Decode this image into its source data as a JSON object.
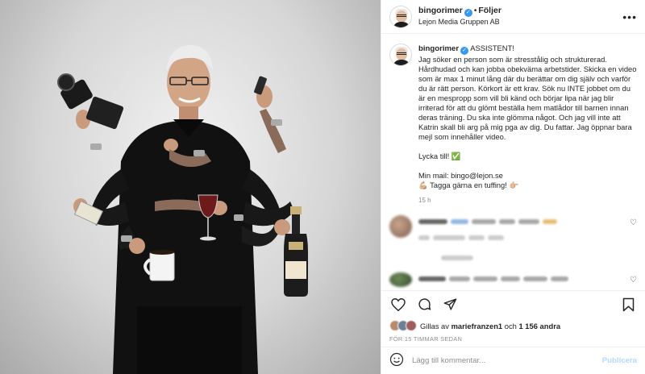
{
  "header": {
    "username": "bingorimer",
    "verified_mark": "✓",
    "separator": "•",
    "follow_label": "Följer",
    "subtitle": "Lejon Media Gruppen AB",
    "more_label": "•••"
  },
  "caption": {
    "username": "bingorimer",
    "verified_mark": "✓",
    "title": "ASSISTENT!",
    "paragraph1": "Jag söker en person som är stresstålig och strukturerad. Hårdhudad och kan jobba obekväma arbetstider. Skicka en video som är max 1 minut lång där du berättar om dig själv och varför du är rätt person. Körkort är ett krav. Sök nu INTE jobbet om du är en mespropp som vill bli känd och börjar lipa när jag blir irriterad för att du glömt beställa hem matlådor till barnen innan deras träning. Du ska inte glömma något. Och jag vill inte att Katrin skall bli arg på mig pga av dig. Du fattar. Jag öppnar bara mejl som innehåller video.",
    "luck": "Lycka till! ✅",
    "mail": "Min mail: bingo@lejon.se",
    "tag": "💪🏼 Tagga gärna en tuffing! 👉🏼",
    "time": "15 h"
  },
  "comments": [
    {
      "avatar_icon": "blurred-avatar-icon",
      "heart_icon": "heart-outline-icon",
      "heart": "♡"
    },
    {
      "avatar_icon": "blurred-avatar-icon",
      "heart_icon": "heart-outline-icon",
      "heart": "♡"
    }
  ],
  "actions": {
    "like_icon": "heart-outline-icon",
    "comment_icon": "comment-icon",
    "share_icon": "paper-plane-icon",
    "save_icon": "bookmark-icon"
  },
  "likes": {
    "prefix": "Gillas av",
    "user": "mariefranzen1",
    "conj": "och",
    "others": "1 156 andra"
  },
  "posted_ago": "FÖR 15 TIMMAR SEDAN",
  "comment_box": {
    "emoji_icon": "smiley-icon",
    "placeholder": "Lägg till kommentar...",
    "post_label": "Publicera"
  },
  "colors": {
    "accent": "#3897f0",
    "post_disabled": "#b3dbff",
    "muted": "#8e8e8e"
  }
}
